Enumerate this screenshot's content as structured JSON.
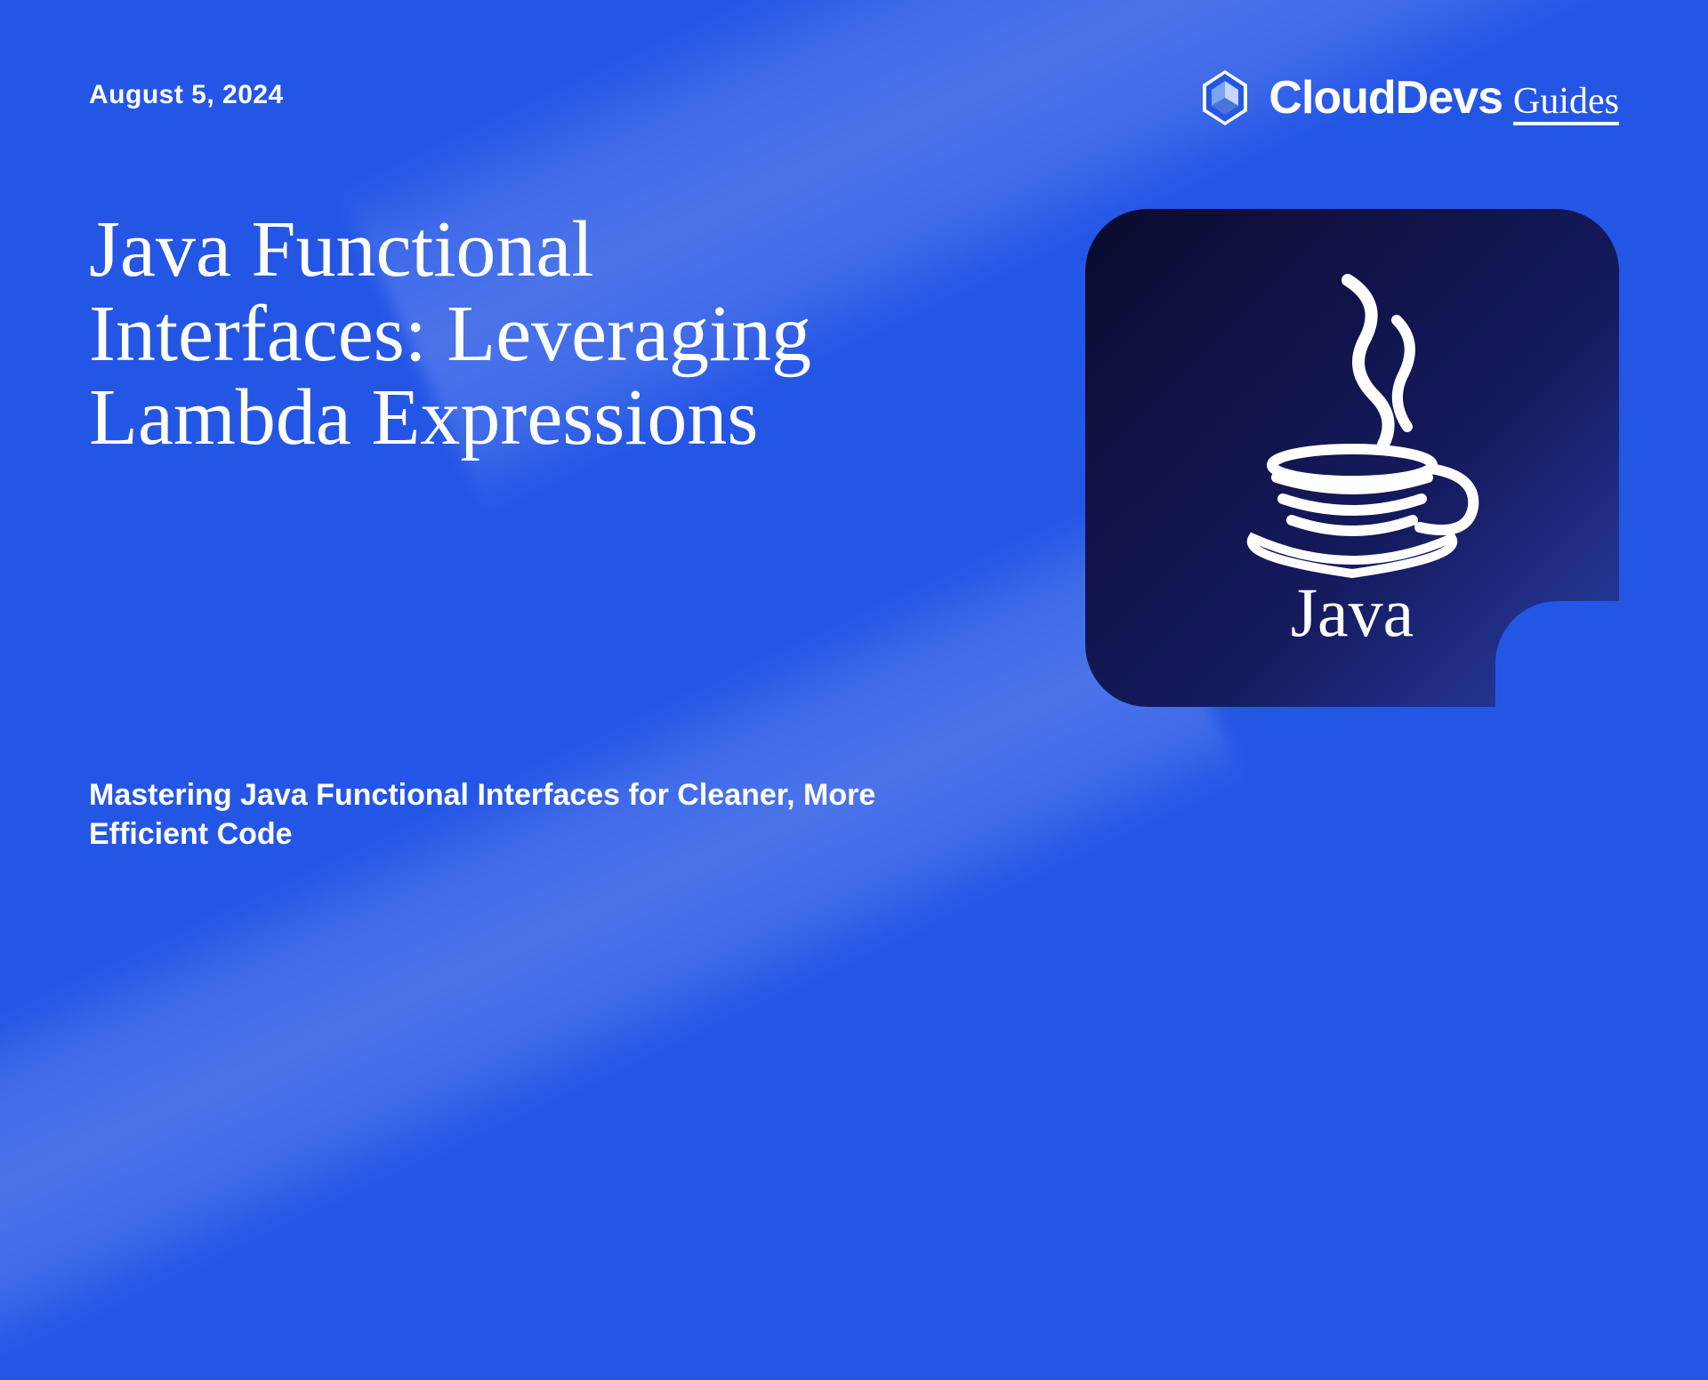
{
  "date": "August 5, 2024",
  "title": "Java Functional Interfaces: Leveraging Lambda Expressions",
  "subtitle": "Mastering Java Functional Interfaces for Cleaner, More Efficient Code",
  "brand": {
    "name": "CloudDevs",
    "suffix": "Guides"
  },
  "card": {
    "technology": "Java"
  },
  "colors": {
    "background": "#2456e6",
    "card_gradient_start": "#0a0b2e",
    "card_gradient_end": "#2a3fa8",
    "text": "#ffffff"
  }
}
